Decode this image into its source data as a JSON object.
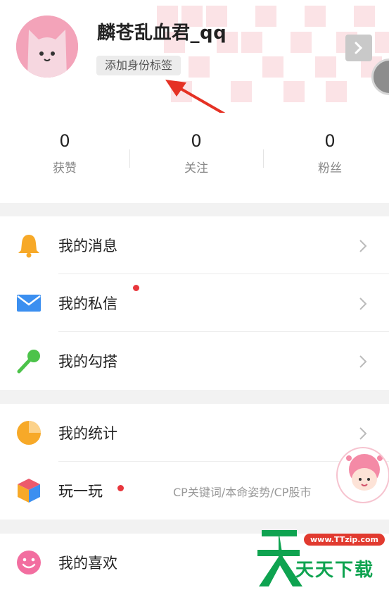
{
  "profile": {
    "username": "麟苍乱血君_qq",
    "tag_button": "添加身份标签"
  },
  "stats": [
    {
      "value": "0",
      "label": "获赞"
    },
    {
      "value": "0",
      "label": "关注"
    },
    {
      "value": "0",
      "label": "粉丝"
    }
  ],
  "menu": {
    "messages": "我的消息",
    "private_letters": "我的私信",
    "hookups": "我的勾搭",
    "statistics": "我的统计",
    "play": "玩一玩",
    "play_subtitle": "CP关键词/本命姿势/CP股市",
    "likes": "我的喜欢"
  },
  "watermark": {
    "url": "www.TTzip.com",
    "text": "天天下载"
  },
  "colors": {
    "accent_red": "#e8363c",
    "bell": "#f7a928",
    "mail": "#3b8ff0",
    "mic": "#4cc34a",
    "pie": "#f7a928",
    "likes": "#f26ea0"
  },
  "icons": [
    "bell-icon",
    "mail-icon",
    "microphone-icon",
    "pie-chart-icon",
    "cube-icon",
    "smile-icon",
    "chevron-right-icon"
  ]
}
